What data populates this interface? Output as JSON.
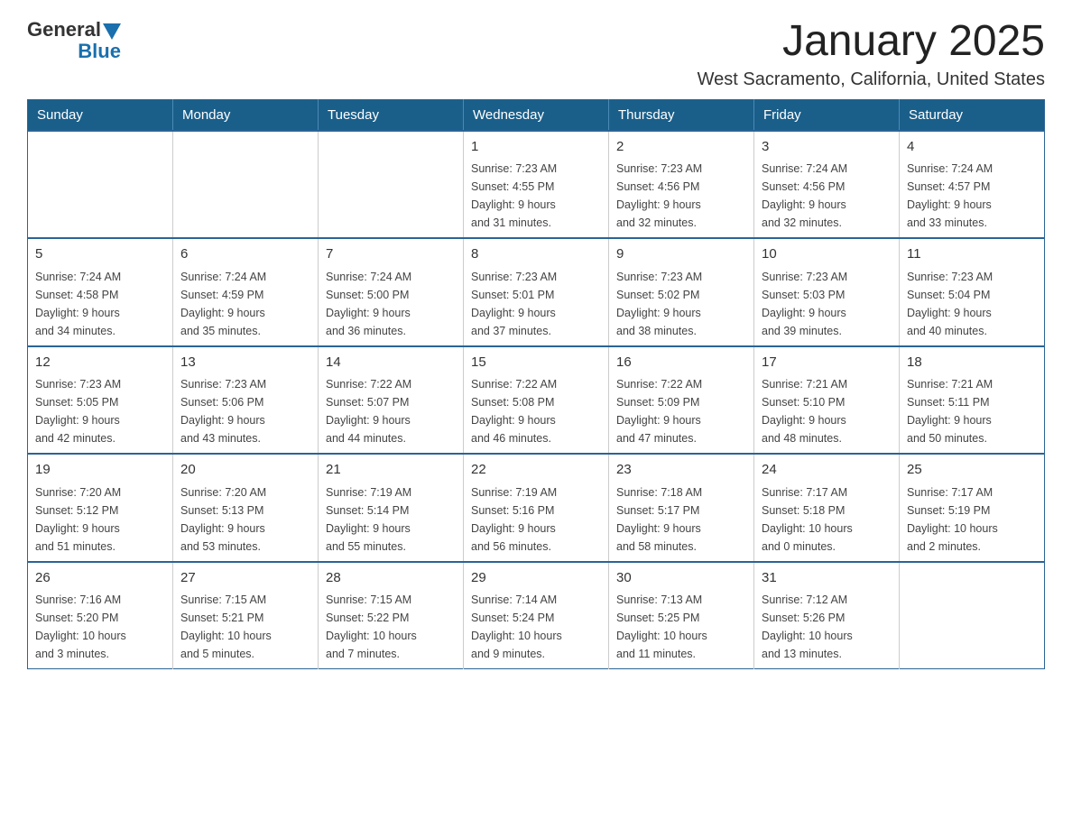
{
  "logo": {
    "text_general": "General",
    "text_blue": "Blue",
    "triangle_color": "#1a6fad"
  },
  "title": "January 2025",
  "subtitle": "West Sacramento, California, United States",
  "header": {
    "days": [
      "Sunday",
      "Monday",
      "Tuesday",
      "Wednesday",
      "Thursday",
      "Friday",
      "Saturday"
    ]
  },
  "weeks": [
    [
      {
        "day": "",
        "info": ""
      },
      {
        "day": "",
        "info": ""
      },
      {
        "day": "",
        "info": ""
      },
      {
        "day": "1",
        "info": "Sunrise: 7:23 AM\nSunset: 4:55 PM\nDaylight: 9 hours\nand 31 minutes."
      },
      {
        "day": "2",
        "info": "Sunrise: 7:23 AM\nSunset: 4:56 PM\nDaylight: 9 hours\nand 32 minutes."
      },
      {
        "day": "3",
        "info": "Sunrise: 7:24 AM\nSunset: 4:56 PM\nDaylight: 9 hours\nand 32 minutes."
      },
      {
        "day": "4",
        "info": "Sunrise: 7:24 AM\nSunset: 4:57 PM\nDaylight: 9 hours\nand 33 minutes."
      }
    ],
    [
      {
        "day": "5",
        "info": "Sunrise: 7:24 AM\nSunset: 4:58 PM\nDaylight: 9 hours\nand 34 minutes."
      },
      {
        "day": "6",
        "info": "Sunrise: 7:24 AM\nSunset: 4:59 PM\nDaylight: 9 hours\nand 35 minutes."
      },
      {
        "day": "7",
        "info": "Sunrise: 7:24 AM\nSunset: 5:00 PM\nDaylight: 9 hours\nand 36 minutes."
      },
      {
        "day": "8",
        "info": "Sunrise: 7:23 AM\nSunset: 5:01 PM\nDaylight: 9 hours\nand 37 minutes."
      },
      {
        "day": "9",
        "info": "Sunrise: 7:23 AM\nSunset: 5:02 PM\nDaylight: 9 hours\nand 38 minutes."
      },
      {
        "day": "10",
        "info": "Sunrise: 7:23 AM\nSunset: 5:03 PM\nDaylight: 9 hours\nand 39 minutes."
      },
      {
        "day": "11",
        "info": "Sunrise: 7:23 AM\nSunset: 5:04 PM\nDaylight: 9 hours\nand 40 minutes."
      }
    ],
    [
      {
        "day": "12",
        "info": "Sunrise: 7:23 AM\nSunset: 5:05 PM\nDaylight: 9 hours\nand 42 minutes."
      },
      {
        "day": "13",
        "info": "Sunrise: 7:23 AM\nSunset: 5:06 PM\nDaylight: 9 hours\nand 43 minutes."
      },
      {
        "day": "14",
        "info": "Sunrise: 7:22 AM\nSunset: 5:07 PM\nDaylight: 9 hours\nand 44 minutes."
      },
      {
        "day": "15",
        "info": "Sunrise: 7:22 AM\nSunset: 5:08 PM\nDaylight: 9 hours\nand 46 minutes."
      },
      {
        "day": "16",
        "info": "Sunrise: 7:22 AM\nSunset: 5:09 PM\nDaylight: 9 hours\nand 47 minutes."
      },
      {
        "day": "17",
        "info": "Sunrise: 7:21 AM\nSunset: 5:10 PM\nDaylight: 9 hours\nand 48 minutes."
      },
      {
        "day": "18",
        "info": "Sunrise: 7:21 AM\nSunset: 5:11 PM\nDaylight: 9 hours\nand 50 minutes."
      }
    ],
    [
      {
        "day": "19",
        "info": "Sunrise: 7:20 AM\nSunset: 5:12 PM\nDaylight: 9 hours\nand 51 minutes."
      },
      {
        "day": "20",
        "info": "Sunrise: 7:20 AM\nSunset: 5:13 PM\nDaylight: 9 hours\nand 53 minutes."
      },
      {
        "day": "21",
        "info": "Sunrise: 7:19 AM\nSunset: 5:14 PM\nDaylight: 9 hours\nand 55 minutes."
      },
      {
        "day": "22",
        "info": "Sunrise: 7:19 AM\nSunset: 5:16 PM\nDaylight: 9 hours\nand 56 minutes."
      },
      {
        "day": "23",
        "info": "Sunrise: 7:18 AM\nSunset: 5:17 PM\nDaylight: 9 hours\nand 58 minutes."
      },
      {
        "day": "24",
        "info": "Sunrise: 7:17 AM\nSunset: 5:18 PM\nDaylight: 10 hours\nand 0 minutes."
      },
      {
        "day": "25",
        "info": "Sunrise: 7:17 AM\nSunset: 5:19 PM\nDaylight: 10 hours\nand 2 minutes."
      }
    ],
    [
      {
        "day": "26",
        "info": "Sunrise: 7:16 AM\nSunset: 5:20 PM\nDaylight: 10 hours\nand 3 minutes."
      },
      {
        "day": "27",
        "info": "Sunrise: 7:15 AM\nSunset: 5:21 PM\nDaylight: 10 hours\nand 5 minutes."
      },
      {
        "day": "28",
        "info": "Sunrise: 7:15 AM\nSunset: 5:22 PM\nDaylight: 10 hours\nand 7 minutes."
      },
      {
        "day": "29",
        "info": "Sunrise: 7:14 AM\nSunset: 5:24 PM\nDaylight: 10 hours\nand 9 minutes."
      },
      {
        "day": "30",
        "info": "Sunrise: 7:13 AM\nSunset: 5:25 PM\nDaylight: 10 hours\nand 11 minutes."
      },
      {
        "day": "31",
        "info": "Sunrise: 7:12 AM\nSunset: 5:26 PM\nDaylight: 10 hours\nand 13 minutes."
      },
      {
        "day": "",
        "info": ""
      }
    ]
  ]
}
